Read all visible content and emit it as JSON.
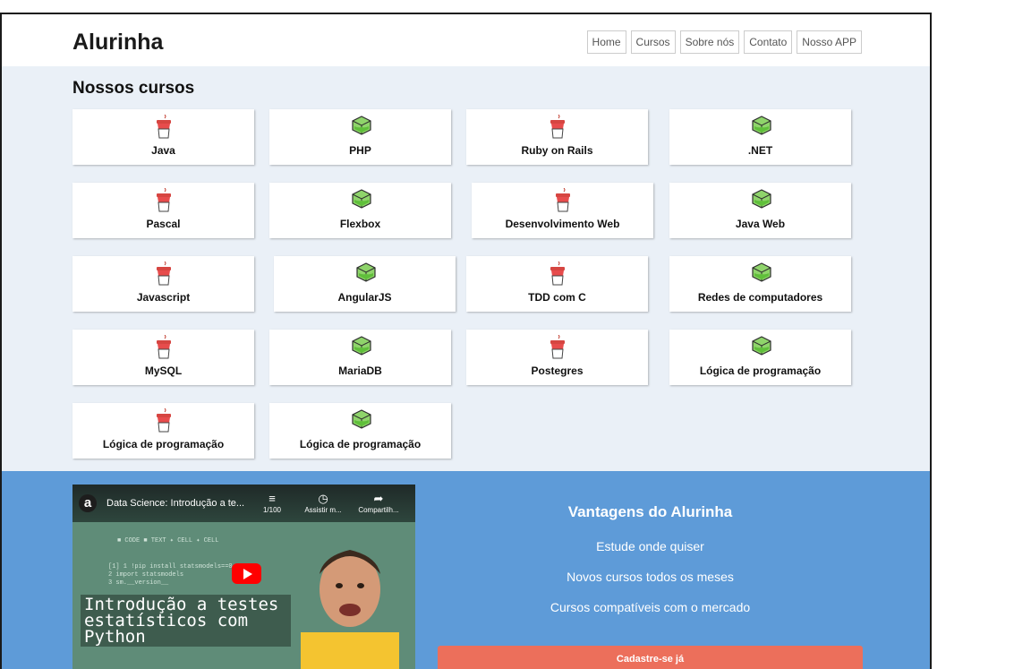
{
  "header": {
    "logo": "Alurinha",
    "nav": [
      "Home",
      "Cursos",
      "Sobre nós",
      "Contato",
      "Nosso APP"
    ]
  },
  "courses": {
    "title": "Nossos cursos",
    "items": [
      {
        "label": "Java",
        "icon": "cup-icon"
      },
      {
        "label": "PHP",
        "icon": "cube-icon"
      },
      {
        "label": "Ruby on Rails",
        "icon": "cup-icon"
      },
      {
        "label": ".NET",
        "icon": "cube-icon"
      },
      {
        "label": "Pascal",
        "icon": "cup-icon"
      },
      {
        "label": "Flexbox",
        "icon": "cube-icon"
      },
      {
        "label": "Desenvolvimento Web",
        "icon": "cup-icon"
      },
      {
        "label": "Java Web",
        "icon": "cube-icon"
      },
      {
        "label": "Javascript",
        "icon": "cup-icon"
      },
      {
        "label": "AngularJS",
        "icon": "cube-icon"
      },
      {
        "label": "TDD com C",
        "icon": "cup-icon"
      },
      {
        "label": "Redes de computadores",
        "icon": "cube-icon"
      },
      {
        "label": "MySQL",
        "icon": "cup-icon"
      },
      {
        "label": "MariaDB",
        "icon": "cube-icon"
      },
      {
        "label": "Postegres",
        "icon": "cup-icon"
      },
      {
        "label": "Lógica de programação",
        "icon": "cube-icon"
      },
      {
        "label": "Lógica de programação",
        "icon": "cup-icon"
      },
      {
        "label": "Lógica de programação",
        "icon": "cube-icon"
      }
    ]
  },
  "video": {
    "channel_letter": "a",
    "title": "Data Science: Introdução a te...",
    "playlist_count": "1/100",
    "watch_later": "Assistir m...",
    "share": "Compartilh...",
    "overlay": "Introdução a testes estatísticos com Python"
  },
  "perks": {
    "title": "Vantagens do Alurinha",
    "items": [
      "Estude onde quiser",
      "Novos cursos todos os meses",
      "Cursos compatíveis com o mercado"
    ],
    "cta": "Cadastre-se já"
  },
  "colors": {
    "footer_bg": "#5e9bd8",
    "cta_bg": "#ec6f5b",
    "main_bg": "#eaf0f7"
  }
}
